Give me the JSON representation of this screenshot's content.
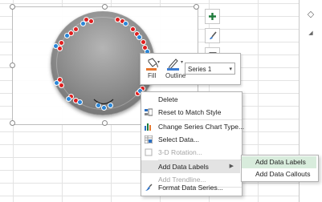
{
  "context_menu": {
    "items": [
      {
        "label": "Delete",
        "icon": "none",
        "enabled": true
      },
      {
        "label": "Reset to Match Style",
        "icon": "reset-style-icon",
        "enabled": true
      },
      {
        "label": "Change Series Chart Type...",
        "icon": "chart-type-icon",
        "enabled": true
      },
      {
        "label": "Select Data...",
        "icon": "select-data-icon",
        "enabled": true
      },
      {
        "label": "3-D Rotation...",
        "icon": "rotation-3d-icon",
        "enabled": false
      },
      {
        "label": "Add Data Labels",
        "icon": "none",
        "enabled": true,
        "submenu": true
      },
      {
        "label": "Add Trendline...",
        "icon": "none",
        "enabled": false
      },
      {
        "label": "Format Data Series...",
        "icon": "format-series-icon",
        "enabled": true
      }
    ]
  },
  "submenu": {
    "items": [
      {
        "label": "Add Data Labels"
      },
      {
        "label": "Add Data Callouts"
      }
    ]
  },
  "mini_toolbar": {
    "fill_label": "Fill",
    "outline_label": "Outline",
    "series_value": "Series 1"
  },
  "colors": {
    "fill_swatch": "#e8772e",
    "outline_swatch": "#3c7dd4",
    "point_selected": "#2a86d8",
    "point_marker": "#e01e1e",
    "submenu_hover": "#d8ecdc",
    "add_button": "#1e7b3b"
  },
  "side_buttons": [
    "chart-elements-plus-icon",
    "chart-styles-brush-icon",
    "chart-filters-funnel-icon"
  ]
}
